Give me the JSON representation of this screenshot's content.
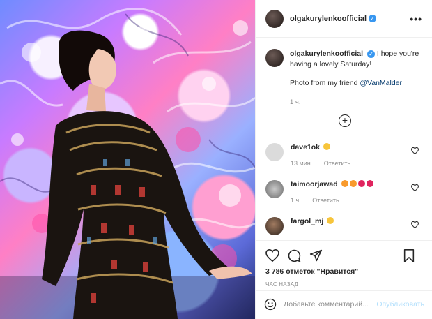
{
  "post": {
    "username": "olgakurylenkoofficial",
    "verified_mark": "✓",
    "more_label": "•••",
    "caption_text": "I hope you're having a lovely Saturday!",
    "caption_sub": "Photo from my friend ",
    "caption_link": "@VanMalder",
    "caption_time": "1 ч.",
    "load_more": "+"
  },
  "comments": [
    {
      "user": "dave1ok",
      "emoji_colors": [
        "#f7c53b"
      ],
      "time": "13 мин.",
      "reply": "Ответить"
    },
    {
      "user": "taimoorjawad",
      "emoji_colors": [
        "#f89a2c",
        "#f89a2c",
        "#e0245e",
        "#e0245e"
      ],
      "time": "1 ч.",
      "reply": "Ответить"
    },
    {
      "user": "fargol_mj",
      "emoji_colors": [
        "#f7c53b"
      ],
      "time": "",
      "reply": ""
    }
  ],
  "actions": {
    "likes_text": "3 786 отметок \"Нравится\"",
    "post_time": "ЧАС НАЗАД",
    "comment_placeholder": "Добавьте комментарий...",
    "publish_label": "Опубликовать"
  },
  "icons": {
    "like": "heart-icon",
    "comment": "comment-icon",
    "share": "share-icon",
    "save": "bookmark-icon",
    "emoji": "smiley-icon"
  },
  "colors": {
    "verified": "#3897f0",
    "link": "#00376b",
    "muted": "#8e8e8e",
    "publish_disabled": "#b2dffc"
  }
}
